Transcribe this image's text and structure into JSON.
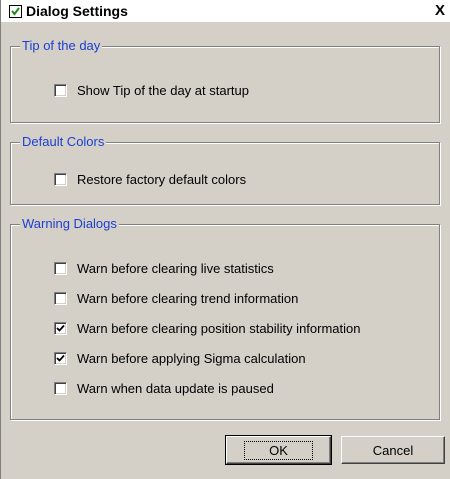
{
  "window": {
    "title": "Dialog Settings",
    "close_symbol": "X",
    "icon": "checkbox-app-icon"
  },
  "groups": {
    "tip": {
      "title": "Tip of the day",
      "items": [
        {
          "label": "Show Tip of the day at startup",
          "checked": false
        }
      ]
    },
    "colors": {
      "title": "Default Colors",
      "items": [
        {
          "label": "Restore factory default colors",
          "checked": false
        }
      ]
    },
    "warnings": {
      "title": "Warning Dialogs",
      "items": [
        {
          "label": "Warn before clearing live statistics",
          "checked": false
        },
        {
          "label": "Warn before clearing trend information",
          "checked": false
        },
        {
          "label": "Warn before clearing position stability information",
          "checked": true
        },
        {
          "label": "Warn before applying Sigma calculation",
          "checked": true
        },
        {
          "label": "Warn when data update is paused",
          "checked": false
        }
      ]
    }
  },
  "buttons": {
    "ok_label": "OK",
    "cancel_label": "Cancel"
  },
  "colors": {
    "group_title": "#1c3fd1",
    "face": "#d4d0c8",
    "app_icon_check": "#1a8a1a"
  }
}
